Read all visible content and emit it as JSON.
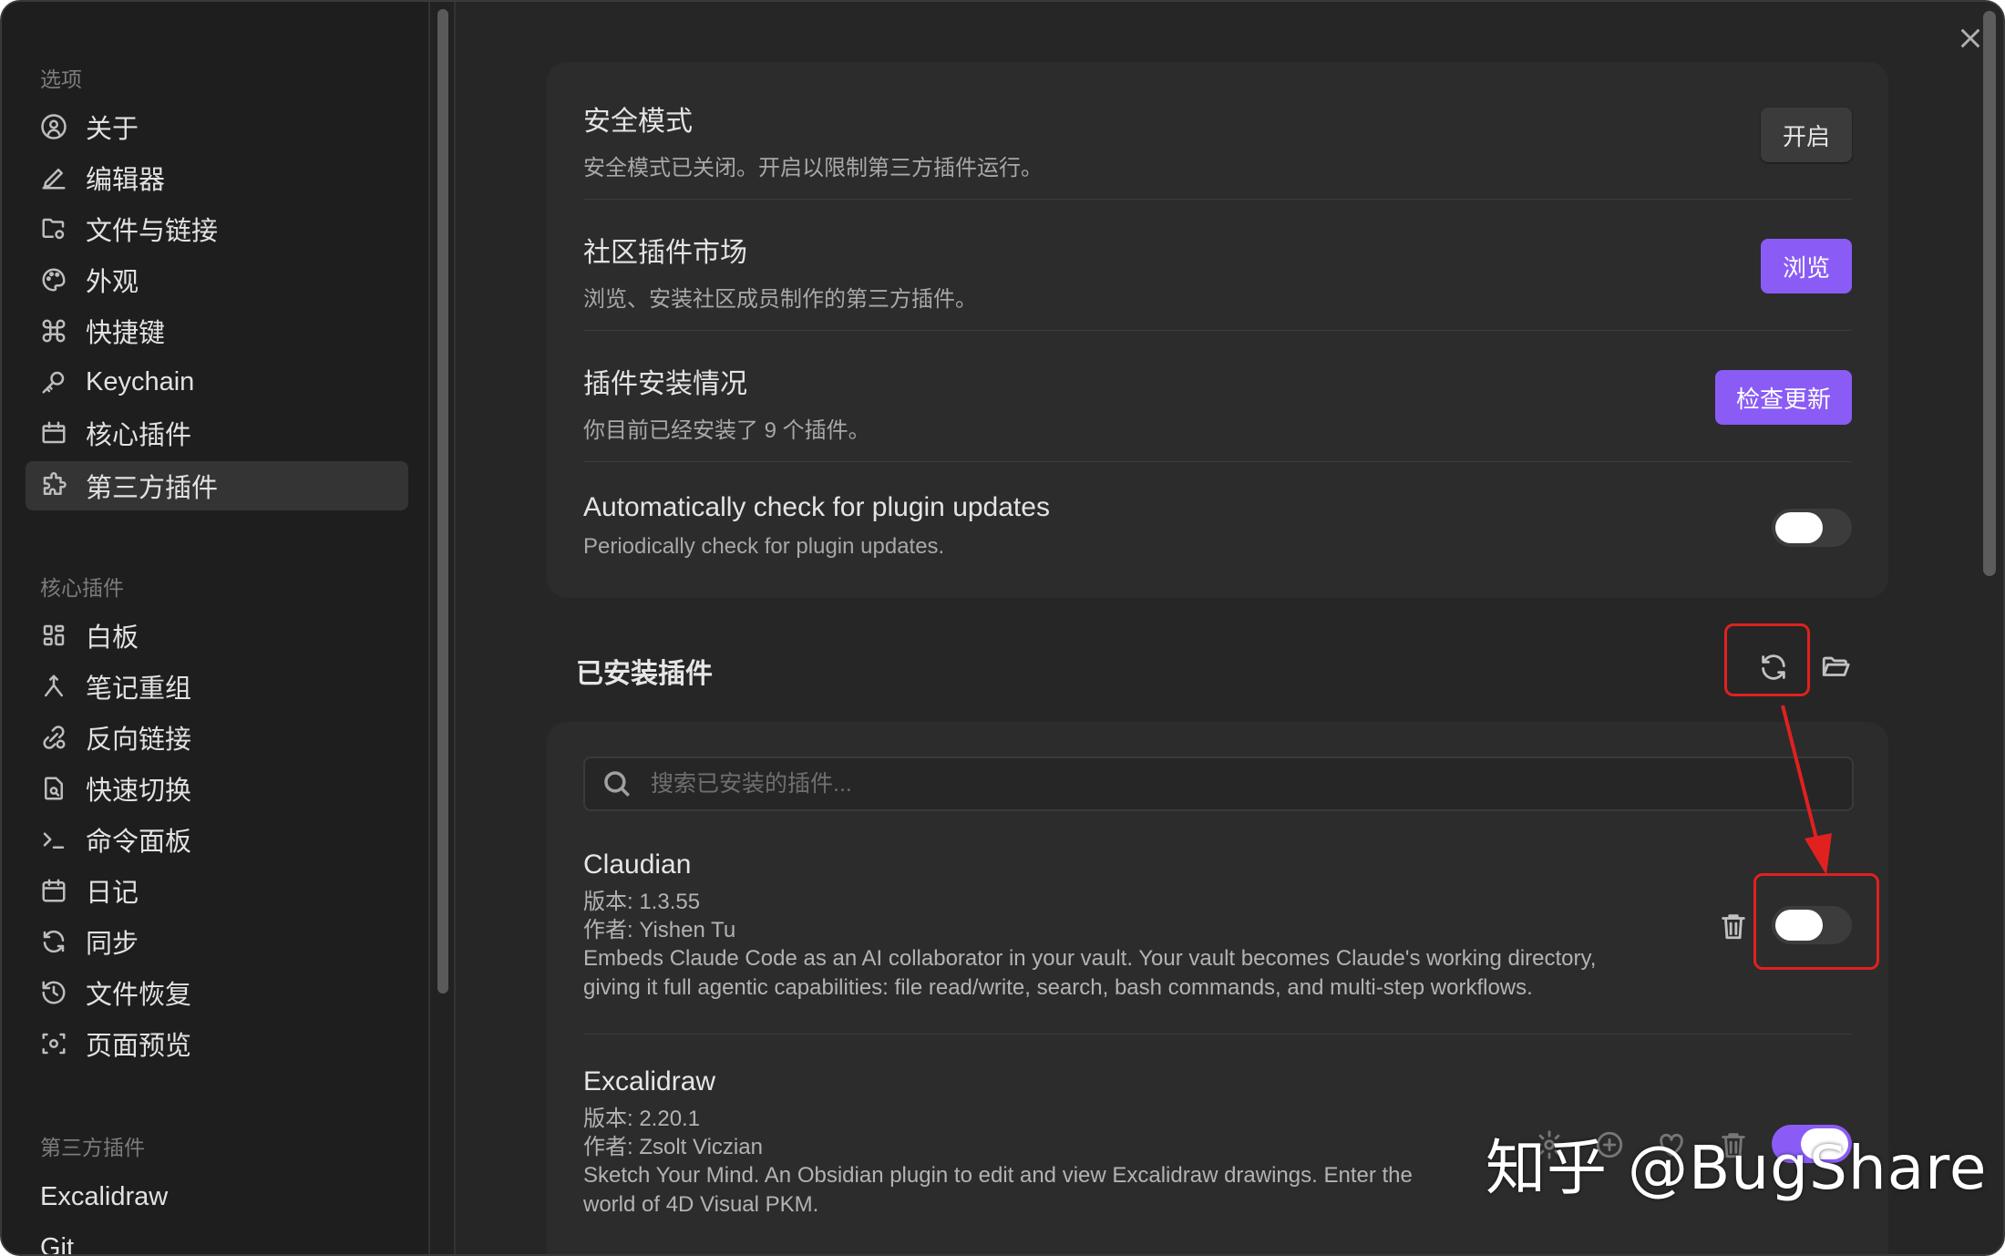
{
  "sidebar": {
    "section_options": "选项",
    "options": [
      {
        "label": "关于",
        "icon": "user-circle-icon"
      },
      {
        "label": "编辑器",
        "icon": "pen-icon"
      },
      {
        "label": "文件与链接",
        "icon": "folder-cog-icon"
      },
      {
        "label": "外观",
        "icon": "palette-icon"
      },
      {
        "label": "快捷键",
        "icon": "command-icon"
      },
      {
        "label": "Keychain",
        "icon": "key-icon"
      },
      {
        "label": "核心插件",
        "icon": "calendar-box-icon"
      },
      {
        "label": "第三方插件",
        "icon": "puzzle-icon",
        "active": true
      }
    ],
    "section_core": "核心插件",
    "core": [
      {
        "label": "白板",
        "icon": "grid-icon"
      },
      {
        "label": "笔记重组",
        "icon": "merge-icon"
      },
      {
        "label": "反向链接",
        "icon": "backlink-icon"
      },
      {
        "label": "快速切换",
        "icon": "file-search-icon"
      },
      {
        "label": "命令面板",
        "icon": "terminal-icon"
      },
      {
        "label": "日记",
        "icon": "calendar-icon"
      },
      {
        "label": "同步",
        "icon": "sync-icon"
      },
      {
        "label": "文件恢复",
        "icon": "history-icon"
      },
      {
        "label": "页面预览",
        "icon": "preview-icon"
      }
    ],
    "section_third": "第三方插件",
    "third": [
      {
        "label": "Excalidraw"
      },
      {
        "label": "Git"
      }
    ]
  },
  "settings": {
    "safe_mode": {
      "title": "安全模式",
      "desc": "安全模式已关闭。开启以限制第三方插件运行。",
      "button": "开启"
    },
    "community": {
      "title": "社区插件市场",
      "desc": "浏览、安装社区成员制作的第三方插件。",
      "button": "浏览"
    },
    "installed_status": {
      "title": "插件安装情况",
      "desc": "你目前已经安装了 9 个插件。",
      "button": "检查更新"
    },
    "auto_check": {
      "title": "Automatically check for plugin updates",
      "desc": "Periodically check for plugin updates.",
      "enabled": false
    }
  },
  "installed": {
    "heading": "已安装插件",
    "search_placeholder": "搜索已安装的插件..."
  },
  "plugins": [
    {
      "name": "Claudian",
      "version": "版本: 1.3.55",
      "author": "作者:  Yishen Tu",
      "desc_line1": "Embeds Claude Code as an AI collaborator in your vault. Your vault becomes Claude's working directory,",
      "desc_line2": "giving it full agentic capabilities: file read/write, search, bash commands, and multi-step workflows.",
      "enabled": false
    },
    {
      "name": "Excalidraw",
      "version": "版本: 2.20.1",
      "author": "作者:  Zsolt Viczian",
      "desc_line1": "Sketch Your Mind. An Obsidian plugin to edit and view Excalidraw drawings. Enter the",
      "desc_line2": "world of 4D Visual PKM.",
      "enabled": true
    }
  ],
  "watermark": "知乎 @BugShare",
  "colors": {
    "accent": "#8a5cf5",
    "annotation": "#e0211f"
  }
}
